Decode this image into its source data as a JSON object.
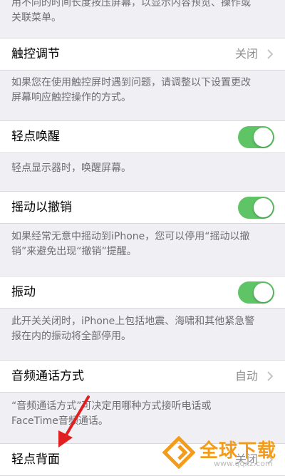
{
  "top_footer_partial": [
    "用不同的时间长度按压屏幕，以显示内容预览、操作或",
    "关联菜单。"
  ],
  "touch_adjust": {
    "label": "触控调节",
    "value": "关闭"
  },
  "touch_adjust_footer": [
    "如果您在使用触控屏时遇到问题，请调整以下设置更改",
    "屏幕响应触控操作的方式。"
  ],
  "tap_to_wake": {
    "label": "轻点唤醒",
    "on": true
  },
  "tap_to_wake_footer": [
    "轻点显示器时，唤醒屏幕。"
  ],
  "shake_to_undo": {
    "label": "摇动以撤销",
    "on": true
  },
  "shake_to_undo_footer": [
    "如果经常无意中摇动到iPhone，您可以停用“摇动以撤",
    "销”来避免出现“撤销”提醒。"
  ],
  "vibration": {
    "label": "振动",
    "on": true
  },
  "vibration_footer": [
    "此开关关闭时，iPhone上包括地震、海啸和其他紧急警",
    "报在内的振动将全部停用。"
  ],
  "call_audio": {
    "label": "音频通话方式",
    "value": "自动"
  },
  "call_audio_footer": [
    "“音频通话方式”可决定用哪种方式接听电话或",
    "FaceTime音频通话。"
  ],
  "back_tap": {
    "label": "轻点背面",
    "value": "关闭"
  },
  "watermark": {
    "text": "全球下载",
    "url": "www.qqxz.com"
  },
  "colors": {
    "toggle_on": "#5ec465",
    "background": "#efeff4",
    "annotation_arrow": "#e02020",
    "watermark": "#f39c1c"
  }
}
